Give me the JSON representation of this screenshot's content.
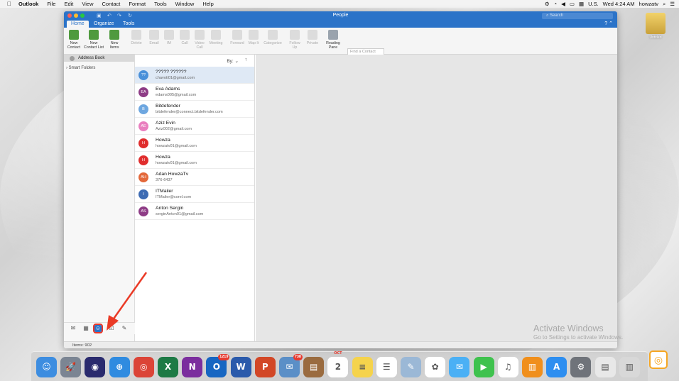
{
  "menubar": {
    "apple": "",
    "app_name": "Outlook",
    "items": [
      "File",
      "Edit",
      "View",
      "Contact",
      "Format",
      "Tools",
      "Window",
      "Help"
    ],
    "right": {
      "locale": "U.S.",
      "clock": "Wed 4:24 AM",
      "user": "howzatv"
    }
  },
  "window": {
    "title": "People",
    "search_placeholder": "Search",
    "tabs": [
      {
        "label": "Home"
      },
      {
        "label": "Organize"
      },
      {
        "label": "Tools"
      }
    ],
    "help": "?"
  },
  "ribbon": {
    "buttons": [
      {
        "label": "New\nContact",
        "icon": "new-contact-icon",
        "enabled": true
      },
      {
        "label": "New\nContact List",
        "icon": "new-contact-list-icon",
        "enabled": true
      },
      {
        "label": "New\nItems",
        "icon": "new-items-icon",
        "enabled": true
      },
      {
        "label": "Delete",
        "icon": "delete-icon",
        "enabled": false
      },
      {
        "label": "Email",
        "icon": "email-icon",
        "enabled": false
      },
      {
        "label": "IM",
        "icon": "im-icon",
        "enabled": false
      },
      {
        "label": "Call",
        "icon": "call-icon",
        "enabled": false
      },
      {
        "label": "Video\nCall",
        "icon": "video-call-icon",
        "enabled": false
      },
      {
        "label": "Meeting",
        "icon": "meeting-icon",
        "enabled": false
      },
      {
        "label": "Forward",
        "icon": "forward-icon",
        "enabled": false
      },
      {
        "label": "Map It",
        "icon": "map-icon",
        "enabled": false
      },
      {
        "label": "Categorize",
        "icon": "categorize-icon",
        "enabled": false
      },
      {
        "label": "Follow\nUp",
        "icon": "follow-up-icon",
        "enabled": false
      },
      {
        "label": "Private",
        "icon": "private-icon",
        "enabled": false
      },
      {
        "label": "Reading\nPane",
        "icon": "reading-pane-icon",
        "enabled": true
      }
    ],
    "find_placeholder": "Find a Contact",
    "address_book": "Address Book"
  },
  "sidebar": {
    "address_book": "Address Book",
    "smart_folders": "Smart Folders"
  },
  "list": {
    "sort_label": "By:",
    "contacts": [
      {
        "initials": "??",
        "name": "????? ??????",
        "email": "chavoti01@gmail.com",
        "color": "#4a90d9"
      },
      {
        "initials": "EA",
        "name": "Eva Adams",
        "email": "edams005@gmail.com",
        "color": "#8e3c86"
      },
      {
        "initials": "B",
        "name": "Bitdefender",
        "email": "bitdefender@connect.bitdefender.com",
        "color": "#6ea7e0"
      },
      {
        "initials": "AE",
        "name": "Aziz Evin",
        "email": "Aziz002@gmail.com",
        "color": "#e97fbf"
      },
      {
        "initials": "H",
        "name": "Howza",
        "email": "howzatv01@gmail.com",
        "color": "#e02d2d"
      },
      {
        "initials": "H",
        "name": "Howza",
        "email": "howzatv01@gmail.com",
        "color": "#e02d2d"
      },
      {
        "initials": "AH",
        "name": "Adan HowzaTv",
        "email": "376-6437",
        "color": "#e3683a"
      },
      {
        "initials": "I",
        "name": "ITMailer",
        "email": "ITMailer@corel.com",
        "color": "#3d6bb3"
      },
      {
        "initials": "AS",
        "name": "Anton Sergin",
        "email": "serginAnton01@gmail.com",
        "color": "#8e3c86"
      }
    ]
  },
  "statusbar": {
    "items": "Items: 902"
  },
  "watermark": {
    "line1": "Activate Windows",
    "line2": "Go to Settings to activate Windows."
  },
  "desktop": {
    "drive_label": "Untitled"
  },
  "dock": {
    "apps": [
      {
        "name": "finder",
        "glyph": "☺",
        "color": "#3d8de0"
      },
      {
        "name": "launchpad",
        "glyph": "🚀",
        "color": "#7b8593"
      },
      {
        "name": "siri",
        "glyph": "◉",
        "color": "#2a2b6e"
      },
      {
        "name": "safari",
        "glyph": "⊕",
        "color": "#2f8be0"
      },
      {
        "name": "chrome",
        "glyph": "◎",
        "color": "#db4437"
      },
      {
        "name": "excel",
        "glyph": "X",
        "color": "#1d7a45"
      },
      {
        "name": "onenote",
        "glyph": "N",
        "color": "#7b2e9e"
      },
      {
        "name": "outlook",
        "glyph": "O",
        "color": "#1766c2",
        "badge": "1219"
      },
      {
        "name": "word",
        "glyph": "W",
        "color": "#2a5aab"
      },
      {
        "name": "powerpoint",
        "glyph": "P",
        "color": "#d24726"
      },
      {
        "name": "preview",
        "glyph": "✉",
        "color": "#5b8fc7",
        "badge": "738"
      },
      {
        "name": "notebook",
        "glyph": "▤",
        "color": "#9a6b3f"
      },
      {
        "name": "calendar",
        "glyph": "2",
        "color": "#ffffff",
        "caption": "OCT"
      },
      {
        "name": "notes",
        "glyph": "≡",
        "color": "#f5d34c"
      },
      {
        "name": "reminders",
        "glyph": "☰",
        "color": "#ffffff"
      },
      {
        "name": "photo-utility",
        "glyph": "✎",
        "color": "#9bb8d6"
      },
      {
        "name": "photos",
        "glyph": "✿",
        "color": "#ffffff"
      },
      {
        "name": "messages",
        "glyph": "✉",
        "color": "#4bb0f5"
      },
      {
        "name": "facetime",
        "glyph": "▶",
        "color": "#3fc24e"
      },
      {
        "name": "itunes",
        "glyph": "♫",
        "color": "#ffffff"
      },
      {
        "name": "ibooks",
        "glyph": "▥",
        "color": "#f08f1c"
      },
      {
        "name": "app-store",
        "glyph": "A",
        "color": "#2d8ef0"
      },
      {
        "name": "system-preferences",
        "glyph": "⚙",
        "color": "#6f737a"
      },
      {
        "name": "downloads-document",
        "glyph": "▤",
        "color": "#e8e8e8"
      },
      {
        "name": "trash",
        "glyph": "▥",
        "color": "#d8d8d8"
      }
    ]
  }
}
